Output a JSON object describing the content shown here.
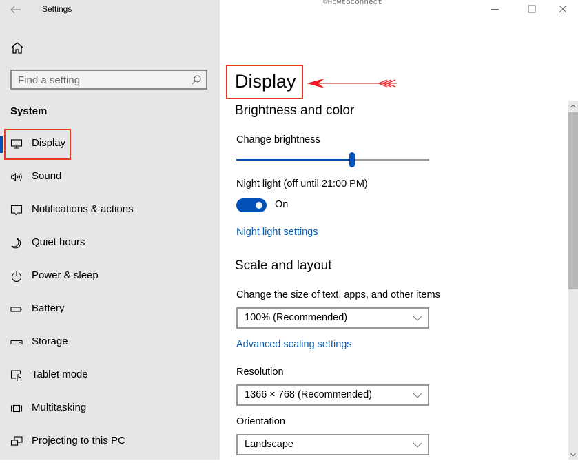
{
  "window": {
    "app_title": "Settings",
    "watermark": "©Howtoconnect",
    "controls": {
      "minimize": "minimize-icon",
      "maximize": "maximize-icon",
      "close": "close-icon"
    }
  },
  "sidebar": {
    "back_icon": "back-arrow-icon",
    "home_icon": "home-icon",
    "search": {
      "placeholder": "Find a setting",
      "value": "",
      "icon": "search-icon"
    },
    "section": "System",
    "items": [
      {
        "label": "Display",
        "icon": "monitor-icon",
        "selected": true
      },
      {
        "label": "Sound",
        "icon": "speaker-icon"
      },
      {
        "label": "Notifications & actions",
        "icon": "notification-icon"
      },
      {
        "label": "Quiet hours",
        "icon": "moon-icon"
      },
      {
        "label": "Power & sleep",
        "icon": "power-icon"
      },
      {
        "label": "Battery",
        "icon": "battery-icon"
      },
      {
        "label": "Storage",
        "icon": "storage-icon"
      },
      {
        "label": "Tablet mode",
        "icon": "tablet-mode-icon"
      },
      {
        "label": "Multitasking",
        "icon": "multitasking-icon"
      },
      {
        "label": "Projecting to this PC",
        "icon": "projecting-icon"
      }
    ]
  },
  "main": {
    "page_title": "Display",
    "brightness_section": {
      "heading": "Brightness and color",
      "brightness_label": "Change brightness",
      "brightness_value_percent": 60,
      "night_light_label": "Night light (off until 21:00 PM)",
      "night_light_toggle": {
        "state": "On",
        "on": true
      },
      "night_light_settings_link": "Night light settings"
    },
    "scale_section": {
      "heading": "Scale and layout",
      "size_label": "Change the size of text, apps, and other items",
      "size_value": "100% (Recommended)",
      "advanced_link": "Advanced scaling settings",
      "resolution_label": "Resolution",
      "resolution_value": "1366 × 768 (Recommended)",
      "orientation_label": "Orientation",
      "orientation_value": "Landscape"
    }
  },
  "annotations": {
    "highlight_color": "#e53a1f",
    "arrow_color": "#ee1c24"
  },
  "colors": {
    "accent": "#0050b8",
    "link": "#0a5fb4",
    "sidebar_bg": "#e6e6e6"
  }
}
